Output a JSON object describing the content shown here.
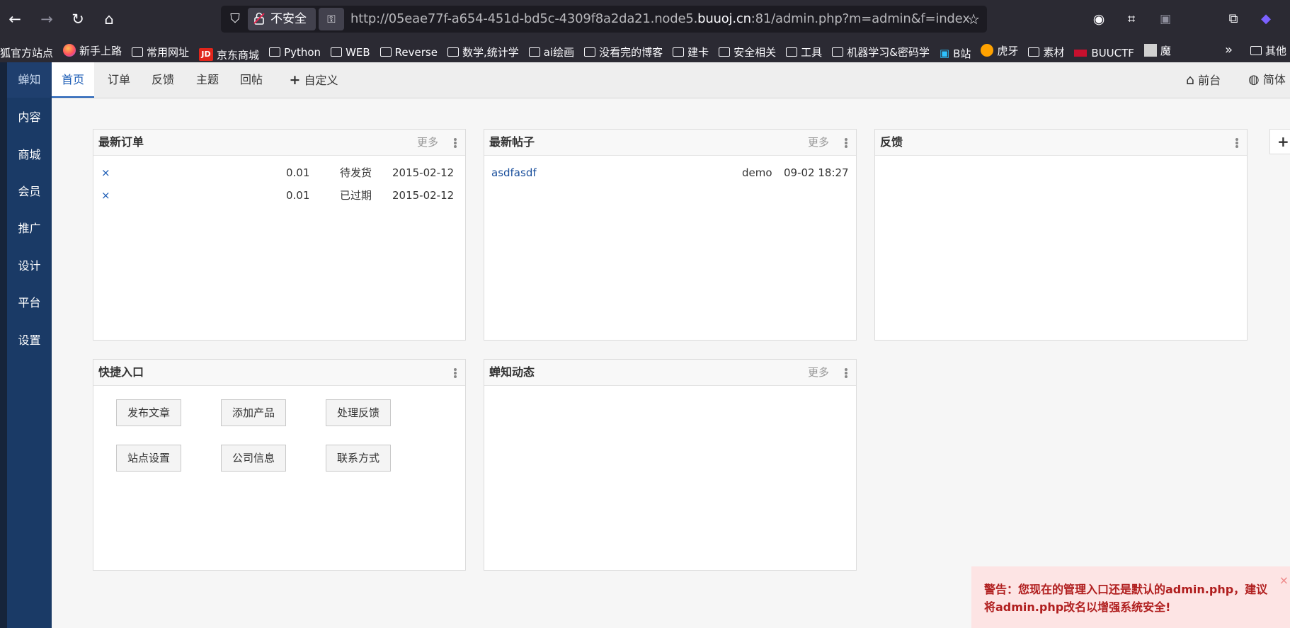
{
  "browser": {
    "url_prefix": "http://05eae77f-a654-451d-bd5c-4309f8a2da21.node5.",
    "url_host": "buuoj.cn",
    "url_suffix": ":81/admin.php?m=admin&f=index",
    "not_secure_label": "不安全"
  },
  "bookmarks": [
    {
      "label": "狐官方站点",
      "icon": "none"
    },
    {
      "label": "新手上路",
      "icon": "firefox-icon"
    },
    {
      "label": "常用网址",
      "icon": "folder-icon"
    },
    {
      "label": "京东商城",
      "icon": "jd-icon"
    },
    {
      "label": "Python",
      "icon": "folder-icon"
    },
    {
      "label": "WEB",
      "icon": "folder-icon"
    },
    {
      "label": "Reverse",
      "icon": "folder-icon"
    },
    {
      "label": "数学,统计学",
      "icon": "folder-icon"
    },
    {
      "label": "ai绘画",
      "icon": "folder-icon"
    },
    {
      "label": "没看完的博客",
      "icon": "folder-icon"
    },
    {
      "label": "建卡",
      "icon": "folder-icon"
    },
    {
      "label": "安全相关",
      "icon": "folder-icon"
    },
    {
      "label": "工具",
      "icon": "folder-icon"
    },
    {
      "label": "机器学习&密码学",
      "icon": "folder-icon"
    },
    {
      "label": "B站",
      "icon": "bilibili-icon"
    },
    {
      "label": "虎牙",
      "icon": "huya-icon"
    },
    {
      "label": "素材",
      "icon": "folder-icon"
    },
    {
      "label": "BUUCTF",
      "icon": "buuctf-icon"
    },
    {
      "label": "魔",
      "icon": "image-icon"
    }
  ],
  "bookmarks_other": "其他",
  "sidenav": {
    "brand": "蝉知",
    "items": [
      "内容",
      "商城",
      "会员",
      "推广",
      "设计",
      "平台",
      "设置"
    ]
  },
  "topnav": {
    "tabs": [
      "首页",
      "订单",
      "反馈",
      "主题",
      "回帖"
    ],
    "custom": "自定义",
    "frontend": "前台",
    "language": "简体"
  },
  "panels": {
    "orders": {
      "title": "最新订单",
      "more": "更多",
      "rows": [
        {
          "x": "×",
          "amount": "0.01",
          "status": "待发货",
          "date": "2015-02-12"
        },
        {
          "x": "×",
          "amount": "0.01",
          "status": "已过期",
          "date": "2015-02-12"
        }
      ]
    },
    "posts": {
      "title": "最新帖子",
      "more": "更多",
      "rows": [
        {
          "title": "asdfasdf",
          "author": "demo",
          "time": "09-02 18:27"
        }
      ]
    },
    "feedback": {
      "title": "反馈"
    },
    "shortcuts": {
      "title": "快捷入口",
      "buttons": [
        "发布文章",
        "添加产品",
        "处理反馈",
        "站点设置",
        "公司信息",
        "联系方式"
      ]
    },
    "news": {
      "title": "蝉知动态",
      "more": "更多"
    }
  },
  "warning": {
    "text": "警告：您现在的管理入口还是默认的admin.php，建议将admin.php改名以增强系统安全!",
    "close": "×"
  }
}
